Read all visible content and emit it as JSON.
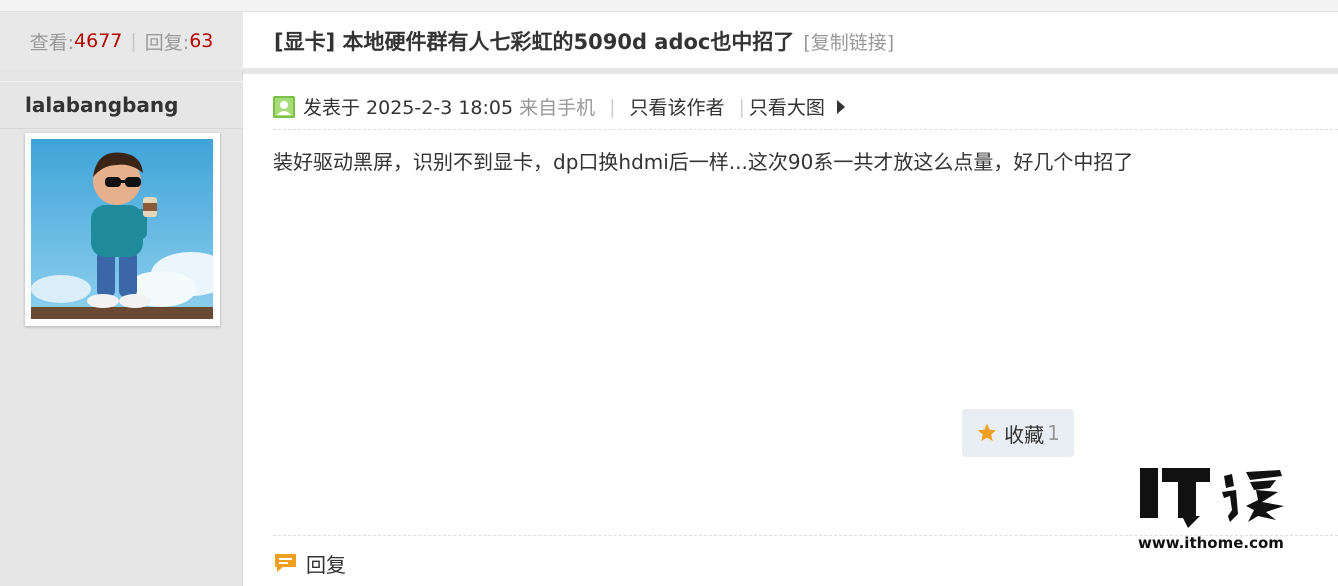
{
  "stats": {
    "views_label": "查看:",
    "views_value": "4677",
    "separator": "|",
    "replies_label": "回复:",
    "replies_value": "63"
  },
  "thread": {
    "title": "[显卡] 本地硬件群有人七彩虹的5090d adoc也中招了",
    "copy_link": "[复制链接]"
  },
  "author": {
    "name": "lalabangbang"
  },
  "post": {
    "posted_at": "发表于 2025-2-3 18:05",
    "from": "来自手机",
    "sep": "|",
    "only_author": "只看该作者",
    "only_large_images": "只看大图",
    "body": "装好驱动黑屏，识别不到显卡，dp口换hdmi后一样...这次90系一共才放这么点量，好几个中招了"
  },
  "actions": {
    "favorite_label": "收藏",
    "favorite_count": "1",
    "reply_label": "回复"
  },
  "watermark": {
    "url": "www.ithome.com"
  },
  "colors": {
    "stat_number": "#b50000",
    "muted": "#999999",
    "text": "#333333",
    "sidebar_bg": "#e6e6e6",
    "star": "#f0a020",
    "reply_icon": "#f0a020"
  },
  "icons": {
    "online": "user-online-icon",
    "arrow": "caret-right-icon",
    "star": "star-icon",
    "reply": "reply-icon"
  }
}
